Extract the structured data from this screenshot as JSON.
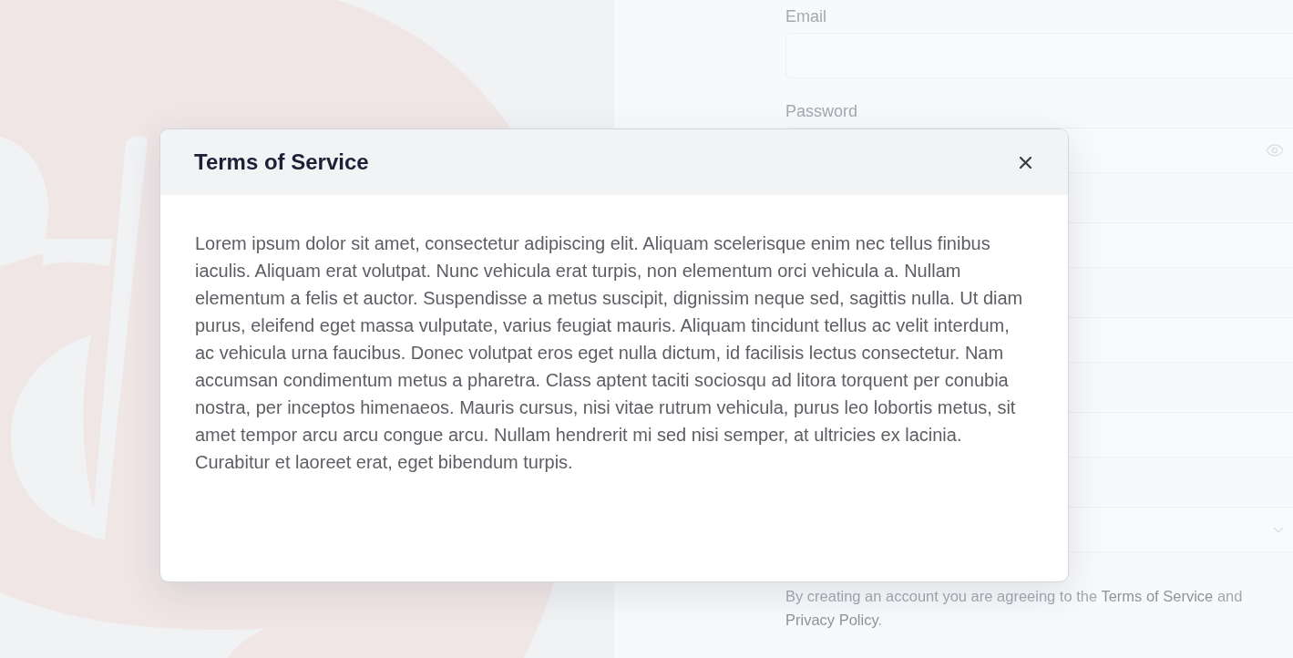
{
  "signup_form": {
    "fields": [
      {
        "label": "Email",
        "kind": "text"
      },
      {
        "label": "Password",
        "kind": "password"
      },
      {
        "kind": "text"
      },
      {
        "kind": "text"
      },
      {
        "kind": "text"
      },
      {
        "kind": "select"
      }
    ],
    "agreement": [
      {
        "kind": "text",
        "text": "By creating an account you are agreeing to the "
      },
      {
        "kind": "link",
        "text": "Terms of Service"
      },
      {
        "kind": "text",
        "text": " and "
      },
      {
        "kind": "link",
        "text": "Privacy Policy"
      },
      {
        "kind": "text",
        "text": "."
      }
    ]
  },
  "dialog": {
    "title": "Terms of Service",
    "body": "Lorem ipsum dolor sit amet, consectetur adipiscing elit. Aliquam scelerisque enim nec tellus finibus iaculis. Aliquam erat volutpat. Nunc vehicula erat turpis, non elementum orci vehicula a. Nullam elementum a felis et auctor. Suspendisse a metus suscipit, dignissim neque sed, sagittis nulla. Ut diam purus, eleifend eget massa vulputate, varius feugiat mauris. Aliquam tincidunt tellus ac velit interdum, ac vehicula urna faucibus. Donec volutpat eros eget nulla dictum, id facilisis lectus consectetur. Nam accumsan condimentum metus a pharetra. Class aptent taciti sociosqu ad litora torquent per conubia nostra, per inceptos himenaeos. Mauris cursus, nisi vitae rutrum vehicula, purus leo lobortis metus, sit amet tempor arcu arcu congue arcu. Nullam hendrerit mi sed nisi semper, at ultricies ex lacinia. Curabitur et laoreet erat, eget bibendum turpis."
  }
}
